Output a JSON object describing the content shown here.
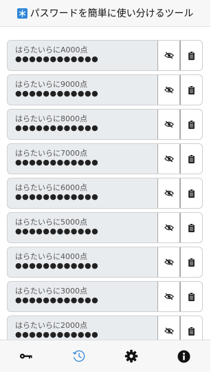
{
  "header": {
    "title": "パスワードを簡単に使い分けるツール"
  },
  "rows": [
    {
      "label": "はらたいらにA000点",
      "masked": "●●●●●●●●●●●●"
    },
    {
      "label": "はらたいらに9000点",
      "masked": "●●●●●●●●●●●●"
    },
    {
      "label": "はらたいらに8000点",
      "masked": "●●●●●●●●●●●●"
    },
    {
      "label": "はらたいらに7000点",
      "masked": "●●●●●●●●●●●●"
    },
    {
      "label": "はらたいらに6000点",
      "masked": "●●●●●●●●●●●●"
    },
    {
      "label": "はらたいらに5000点",
      "masked": "●●●●●●●●●●●●"
    },
    {
      "label": "はらたいらに4000点",
      "masked": "●●●●●●●●●●●●"
    },
    {
      "label": "はらたいらに3000点",
      "masked": "●●●●●●●●●●●●"
    },
    {
      "label": "はらたいらに2000点",
      "masked": "●●●●●●●●●●●●"
    }
  ],
  "tabs": [
    {
      "icon": "key-icon",
      "active": false
    },
    {
      "icon": "history-icon",
      "active": true
    },
    {
      "icon": "gear-icon",
      "active": false
    },
    {
      "icon": "info-icon",
      "active": false
    }
  ],
  "colors": {
    "accent": "#2f86d6",
    "row_bg": "#e9ecef",
    "icon": "#111111"
  }
}
